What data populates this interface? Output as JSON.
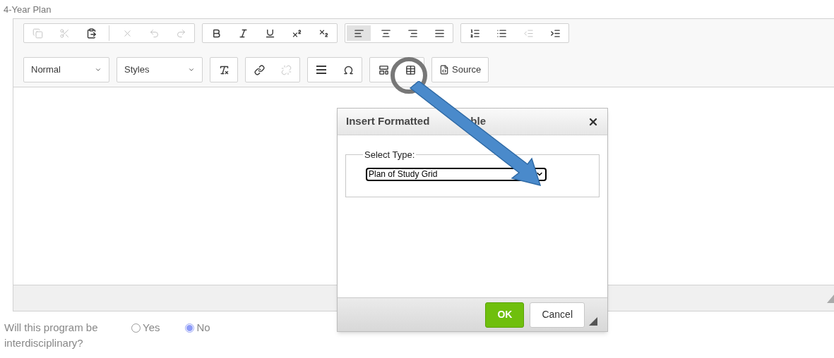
{
  "field_label": "4-Year Plan",
  "toolbar": {
    "rows": [
      [
        [
          {
            "kind": "copy",
            "disabled": true,
            "selected": false
          },
          {
            "kind": "cut",
            "disabled": true,
            "selected": false
          },
          {
            "kind": "paste",
            "disabled": false,
            "selected": false
          },
          {
            "kind": "separator"
          },
          {
            "kind": "remove",
            "disabled": true,
            "selected": false
          },
          {
            "kind": "undo",
            "disabled": true,
            "selected": false
          },
          {
            "kind": "redo",
            "disabled": true,
            "selected": false
          }
        ],
        [
          {
            "kind": "bold",
            "disabled": false,
            "selected": false
          },
          {
            "kind": "italic",
            "disabled": false,
            "selected": false
          },
          {
            "kind": "underline",
            "disabled": false,
            "selected": false
          },
          {
            "kind": "superscript",
            "disabled": false,
            "selected": false
          },
          {
            "kind": "subscript",
            "disabled": false,
            "selected": false
          }
        ],
        [
          {
            "kind": "align-left",
            "disabled": false,
            "selected": true
          },
          {
            "kind": "align-center",
            "disabled": false,
            "selected": false
          },
          {
            "kind": "align-right",
            "disabled": false,
            "selected": false
          },
          {
            "kind": "justify",
            "disabled": false,
            "selected": false
          }
        ],
        [
          {
            "kind": "numbered-list",
            "disabled": false,
            "selected": false
          },
          {
            "kind": "bulleted-list",
            "disabled": false,
            "selected": false
          },
          {
            "kind": "outdent",
            "disabled": true,
            "selected": false
          },
          {
            "kind": "indent",
            "disabled": false,
            "selected": false
          }
        ]
      ],
      [
        [
          {
            "kind": "combo",
            "label": "Normal",
            "disabled": false,
            "selected": false
          }
        ],
        [
          {
            "kind": "combo",
            "label": "Styles",
            "disabled": false,
            "selected": false
          }
        ],
        [
          {
            "kind": "clear-format",
            "disabled": false,
            "selected": false
          }
        ],
        [
          {
            "kind": "link",
            "disabled": false,
            "selected": false
          },
          {
            "kind": "unlink",
            "disabled": true,
            "selected": false
          }
        ],
        [
          {
            "kind": "rule",
            "disabled": false,
            "selected": false
          },
          {
            "kind": "omega",
            "disabled": false,
            "selected": false
          }
        ],
        [
          {
            "kind": "template",
            "disabled": false,
            "selected": false
          },
          {
            "kind": "table",
            "disabled": false,
            "selected": false
          }
        ],
        [
          {
            "kind": "source",
            "label": "Source",
            "disabled": false,
            "selected": false
          }
        ]
      ]
    ]
  },
  "dialog": {
    "title_parts": [
      "Insert Formatted",
      "ble"
    ],
    "fieldset_legend": "Select Type:",
    "select_value": "Plan of Study Grid",
    "buttons": [
      {
        "kind": "primary",
        "label": "OK"
      },
      {
        "kind": "secondary",
        "label": "Cancel"
      }
    ]
  },
  "question": {
    "text": "Will this program be interdisciplinary?",
    "options": [
      {
        "label": "Yes",
        "selected": false
      },
      {
        "label": "No",
        "selected": true
      }
    ]
  }
}
